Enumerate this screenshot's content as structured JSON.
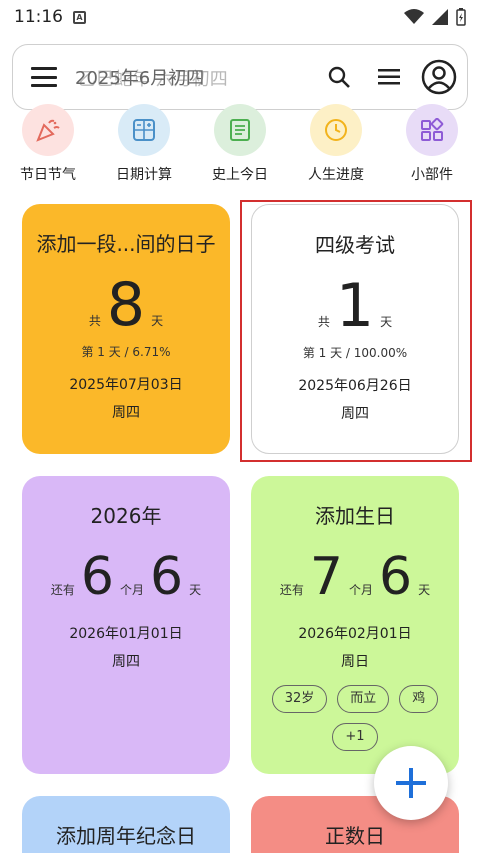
{
  "status_bar": {
    "time": "11:16",
    "notification_badge": "A"
  },
  "search_bar": {
    "title": "2025年6月初四",
    "title_overlay": "乙巳蛇年 六月初四"
  },
  "tools": [
    {
      "label": "节日节气",
      "icon": "party-popper-icon",
      "bg": "#fde2e0",
      "fg": "#e36a5d"
    },
    {
      "label": "日期计算",
      "icon": "calculator-icon",
      "bg": "#d9ebf7",
      "fg": "#4a90c8"
    },
    {
      "label": "史上今日",
      "icon": "document-icon",
      "bg": "#dcefdc",
      "fg": "#4caf50"
    },
    {
      "label": "人生进度",
      "icon": "clock-icon",
      "bg": "#fdf0c6",
      "fg": "#f2b31c"
    },
    {
      "label": "小部件",
      "icon": "widgets-icon",
      "bg": "#e8dcf7",
      "fg": "#8e5bd6"
    }
  ],
  "cards": [
    {
      "title": "添加一段...间的日子",
      "prefix": "共",
      "number": "8",
      "suffix": "天",
      "sub": "第 1 天 / 6.71%",
      "date": "2025年07月03日",
      "week": "周四",
      "bg": "#fbb829"
    },
    {
      "title": "四级考试",
      "prefix": "共",
      "number": "1",
      "suffix": "天",
      "sub": "第 1 天 / 100.00%",
      "date": "2025年06月26日",
      "week": "周四",
      "bg": "#ffffff"
    },
    {
      "title": "2026年",
      "prefix": "还有",
      "months": "6",
      "month_unit": "个月",
      "days": "6",
      "suffix": "天",
      "date": "2026年01月01日",
      "week": "周四",
      "bg": "#d9b8f7"
    },
    {
      "title": "添加生日",
      "prefix": "还有",
      "months": "7",
      "month_unit": "个月",
      "days": "6",
      "suffix": "天",
      "date": "2026年02月01日",
      "week": "周日",
      "tags": [
        "32岁",
        "而立",
        "鸡",
        "+1"
      ],
      "bg": "#ccf799"
    },
    {
      "title": "添加周年纪念日",
      "bg": "#b3d3f9"
    },
    {
      "title": "正数日",
      "bg": "#f48d85"
    }
  ],
  "colors": {
    "accent": "#1e6fd9",
    "selection": "#d32f2f"
  }
}
